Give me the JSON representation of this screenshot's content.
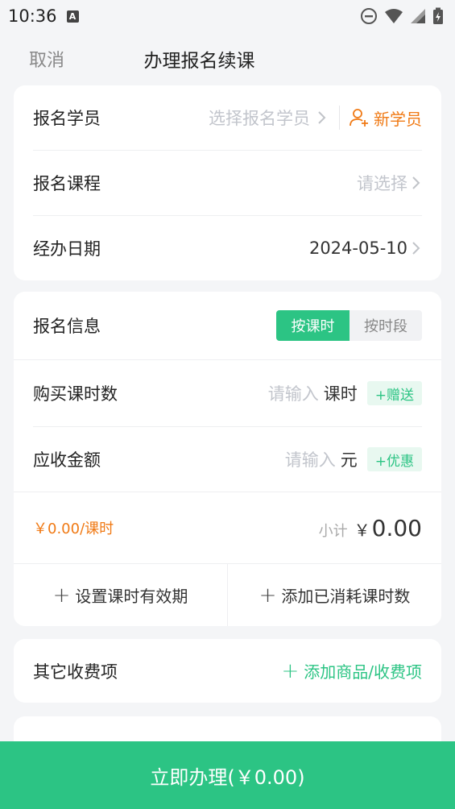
{
  "status_bar": {
    "time": "10:36",
    "notif_icon": "A"
  },
  "nav": {
    "cancel_label": "取消",
    "title": "办理报名续课"
  },
  "basic": {
    "student_label": "报名学员",
    "student_placeholder": "选择报名学员",
    "new_student_label": "新学员",
    "course_label": "报名课程",
    "course_placeholder": "请选择",
    "date_label": "经办日期",
    "date_value": "2024-05-10"
  },
  "enroll": {
    "info_label": "报名信息",
    "mode_by_lesson": "按课时",
    "mode_by_period": "按时段",
    "buy_label": "购买课时数",
    "buy_placeholder": "请输入",
    "buy_unit": "课时",
    "gift_button": "+赠送",
    "amount_label": "应收金额",
    "amount_placeholder": "请输入",
    "amount_unit": "元",
    "discount_button": "+优惠",
    "per_price": "￥0.00/课时",
    "subtotal_label": "小计",
    "subtotal_currency": "￥",
    "subtotal_value": "0.00",
    "set_validity": "设置课时有效期",
    "add_consumed": "添加已消耗课时数"
  },
  "other": {
    "label": "其它收费项",
    "add_link": "添加商品/收费项"
  },
  "footer": {
    "submit_label": "立即办理(￥0.00)"
  },
  "colors": {
    "accent": "#2cc484",
    "orange": "#f07a15"
  }
}
